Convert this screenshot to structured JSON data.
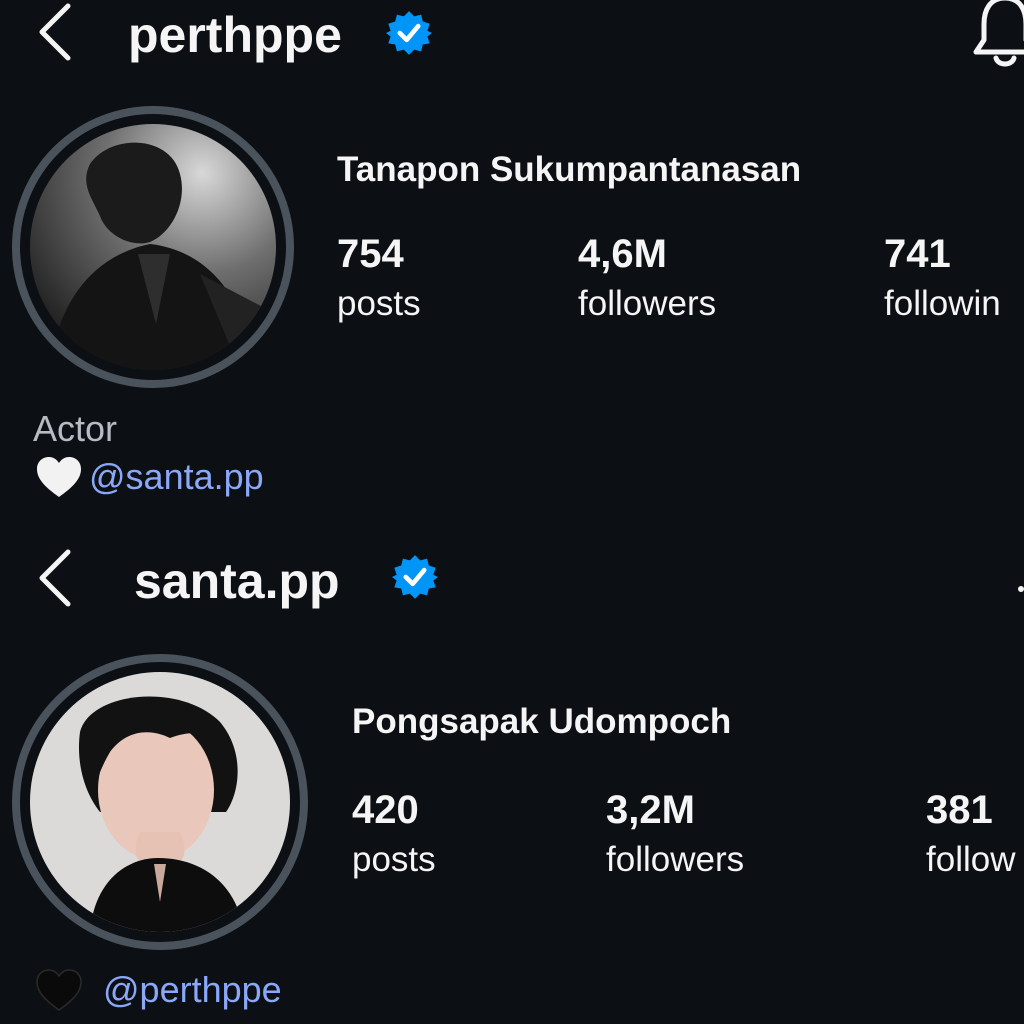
{
  "profiles": [
    {
      "username": "perthppe",
      "full_name": "Tanapon Sukumpantanasan",
      "stats": [
        {
          "value": "754",
          "label": "posts"
        },
        {
          "value": "4,6M",
          "label": "followers"
        },
        {
          "value": "741",
          "label": "followin"
        }
      ],
      "bio": "Actor",
      "link_heart": "white-heart-icon",
      "mention": "@santa.pp"
    },
    {
      "username": "santa.pp",
      "full_name": "Pongsapak Udompoch",
      "stats": [
        {
          "value": "420",
          "label": "posts"
        },
        {
          "value": "3,2M",
          "label": "followers"
        },
        {
          "value": "381",
          "label": "follow"
        }
      ],
      "link_heart": "black-heart-icon",
      "mention": "@perthppe"
    }
  ],
  "icons": {
    "back": "chevron-left-icon",
    "verified": "verified-badge-icon",
    "notifications": "bell-icon"
  },
  "colors": {
    "background": "#0c1014",
    "verified": "#0095f6",
    "mention": "#8aa8f7",
    "avatar_ring": "#4a525c"
  }
}
